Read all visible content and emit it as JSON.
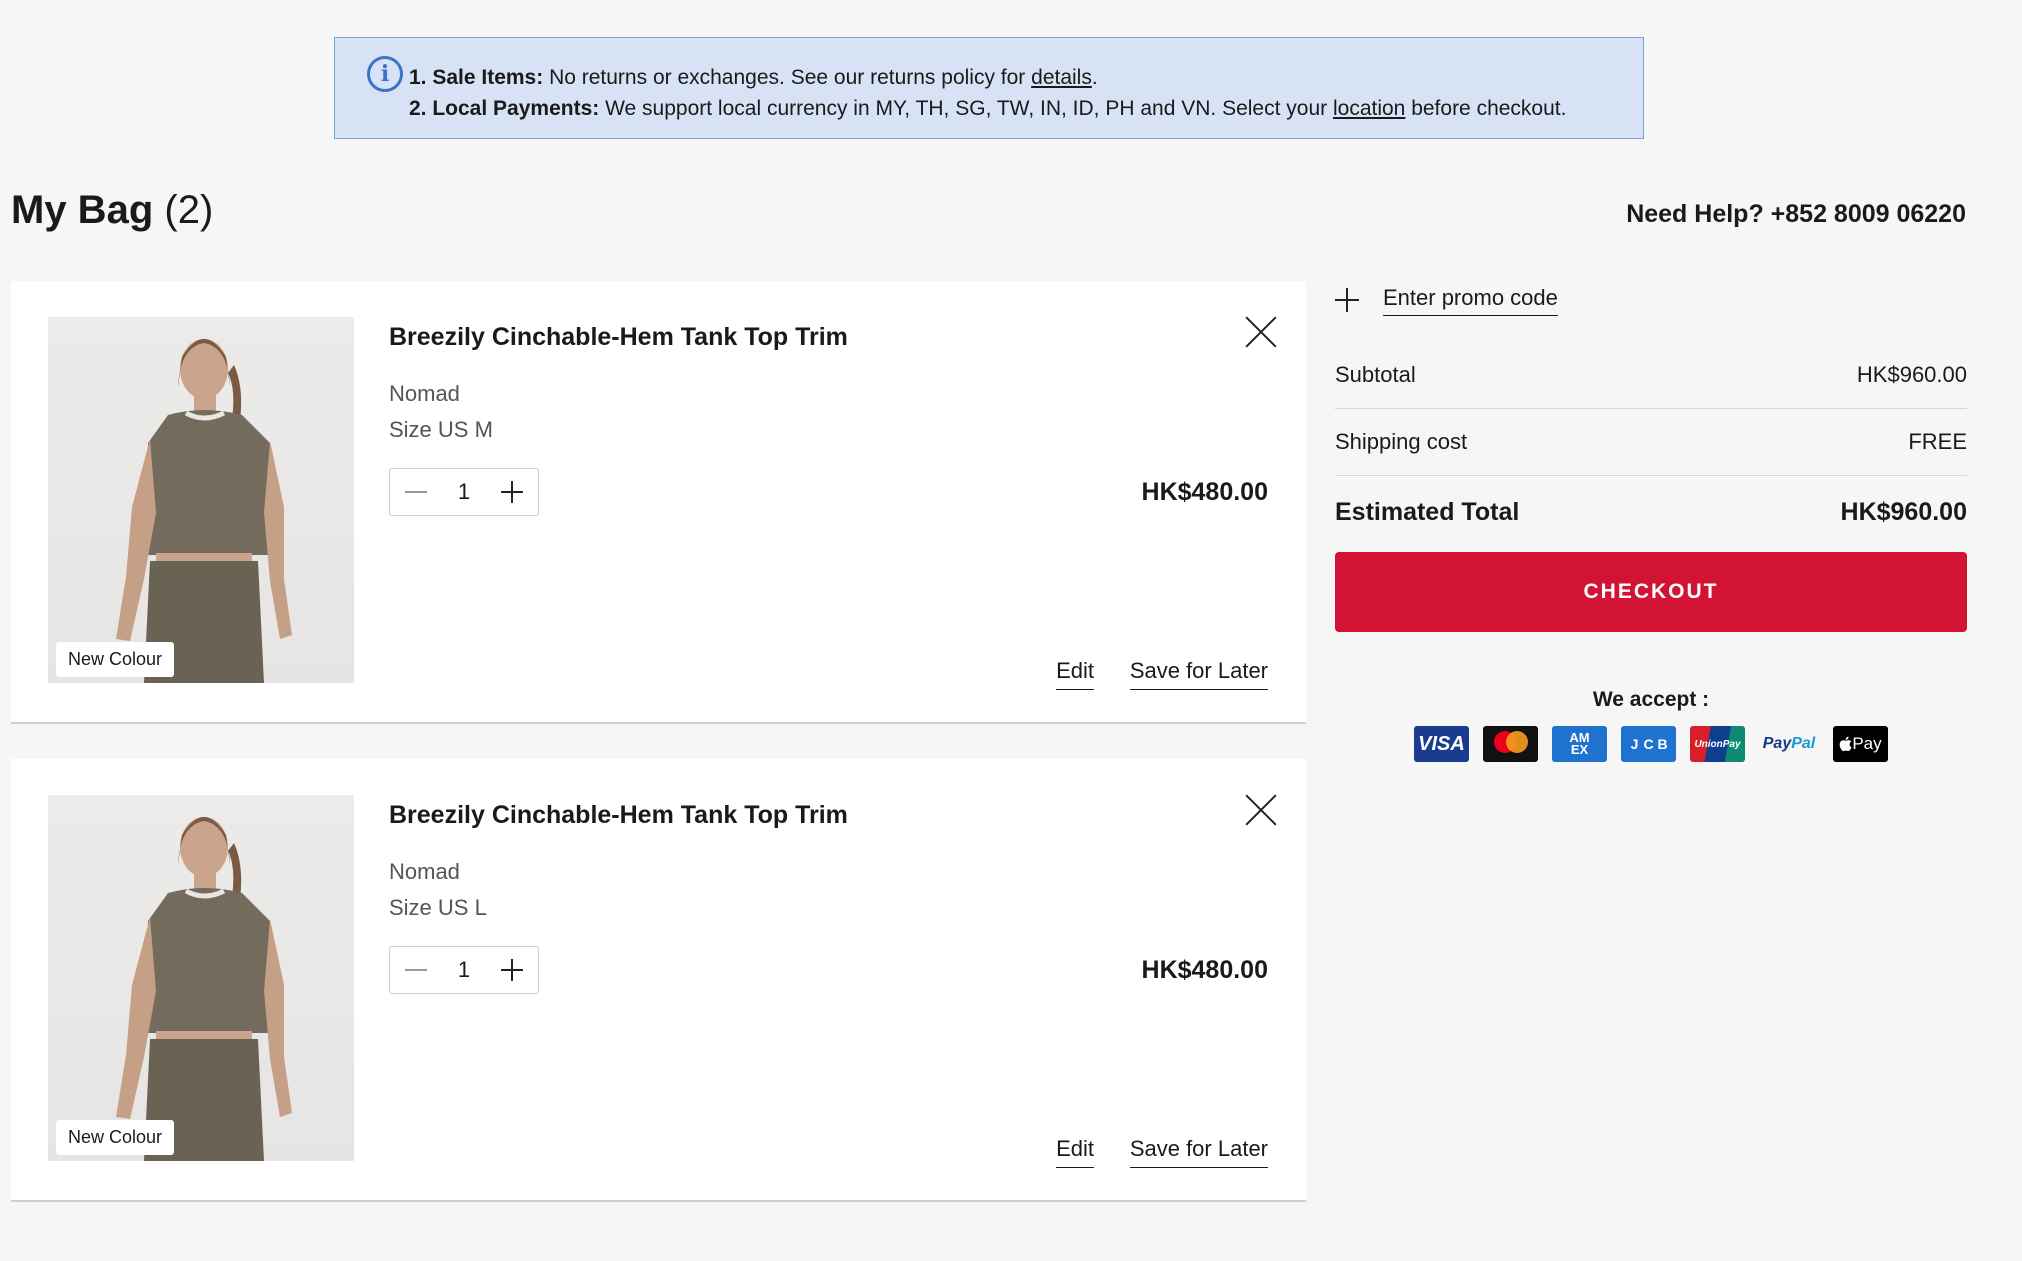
{
  "notice": {
    "line1_label": "1. Sale Items:",
    "line1_text": " No returns or exchanges. See our returns policy for ",
    "line1_link": "details",
    "line1_end": ".",
    "line2_label": "2. Local Payments:",
    "line2_text": " We support local currency in MY, TH, SG, TW, IN, ID, PH and VN. Select your ",
    "line2_link": "location",
    "line2_end": " before checkout."
  },
  "bag": {
    "title": "My Bag",
    "count": "(2)"
  },
  "help": "Need Help? +852 8009 06220",
  "items": [
    {
      "name": "Breezily Cinchable-Hem Tank Top Trim",
      "color": "Nomad",
      "size": "Size US M",
      "quantity": "1",
      "price": "HK$480.00",
      "badge": "New Colour",
      "edit": "Edit",
      "save": "Save for Later"
    },
    {
      "name": "Breezily Cinchable-Hem Tank Top Trim",
      "color": "Nomad",
      "size": "Size US L",
      "quantity": "1",
      "price": "HK$480.00",
      "badge": "New Colour",
      "edit": "Edit",
      "save": "Save for Later"
    }
  ],
  "summary": {
    "promo": "Enter promo code",
    "subtotal_label": "Subtotal",
    "subtotal_value": "HK$960.00",
    "shipping_label": "Shipping cost",
    "shipping_value": "FREE",
    "total_label": "Estimated Total",
    "total_value": "HK$960.00",
    "checkout": "CHECKOUT",
    "accept": "We accept :"
  },
  "payment_methods": {
    "visa": "VISA",
    "amex_line1": "AM",
    "amex_line2": "EX",
    "jcb": [
      "J",
      "C",
      "B"
    ],
    "unionpay": "UnionPay",
    "paypal_a": "Pay",
    "paypal_b": "Pal",
    "applepay": " Pay"
  },
  "colors": {
    "checkout": "#d31334",
    "notice_bg": "#d7e3f4",
    "notice_border": "#7aa3d9",
    "product": "#6f6a5c"
  }
}
